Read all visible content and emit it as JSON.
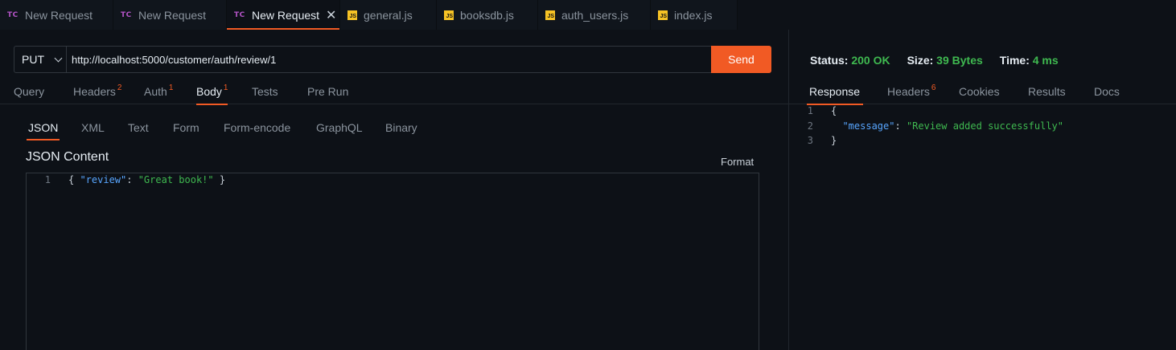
{
  "tabs": [
    {
      "icon": "TC",
      "label": "New Request",
      "active": false
    },
    {
      "icon": "TC",
      "label": "New Request",
      "active": false
    },
    {
      "icon": "TC",
      "label": "New Request",
      "active": true
    },
    {
      "icon": "JS",
      "label": "general.js",
      "active": false
    },
    {
      "icon": "JS",
      "label": "booksdb.js",
      "active": false
    },
    {
      "icon": "JS",
      "label": "auth_users.js",
      "active": false
    },
    {
      "icon": "JS",
      "label": "index.js",
      "active": false
    }
  ],
  "request": {
    "method": "PUT",
    "url": "http://localhost:5000/customer/auth/review/1",
    "send_label": "Send",
    "tabs": [
      {
        "label": "Query",
        "badge": ""
      },
      {
        "label": "Headers",
        "badge": "2"
      },
      {
        "label": "Auth",
        "badge": "1"
      },
      {
        "label": "Body",
        "badge": "1",
        "active": true
      },
      {
        "label": "Tests",
        "badge": ""
      },
      {
        "label": "Pre Run",
        "badge": ""
      }
    ],
    "body_tabs": [
      "JSON",
      "XML",
      "Text",
      "Form",
      "Form-encode",
      "GraphQL",
      "Binary"
    ],
    "body_active": "JSON",
    "json_content_title": "JSON Content",
    "format_label": "Format",
    "body_lines": [
      {
        "n": "1",
        "open": "{ ",
        "key": "\"review\"",
        "sep": ": ",
        "value": "\"Great book!\"",
        "close": " }"
      }
    ]
  },
  "response": {
    "status_label": "Status:",
    "status_value": "200 OK",
    "size_label": "Size:",
    "size_value": "39 Bytes",
    "time_label": "Time:",
    "time_value": "4 ms",
    "tabs": [
      {
        "label": "Response",
        "badge": "",
        "active": true
      },
      {
        "label": "Headers",
        "badge": "6"
      },
      {
        "label": "Cookies",
        "badge": ""
      },
      {
        "label": "Results",
        "badge": ""
      },
      {
        "label": "Docs",
        "badge": ""
      }
    ],
    "lines": [
      {
        "n": "1",
        "text": "{"
      },
      {
        "n": "2",
        "key": "\"message\"",
        "sep": ": ",
        "value": "\"Review added successfully\""
      },
      {
        "n": "3",
        "text": "}"
      }
    ]
  },
  "colors": {
    "accent": "#f15a24",
    "success": "#3fb950",
    "key": "#58a6ff",
    "background": "#0d1117"
  }
}
